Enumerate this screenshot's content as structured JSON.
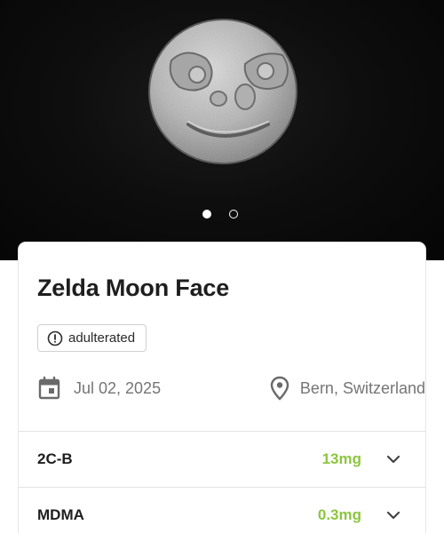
{
  "carousel": {
    "image_icon": "pill-photo-moon-face",
    "active_index": 0,
    "dots": [
      "slide-1",
      "slide-2"
    ]
  },
  "sample": {
    "title": "Zelda Moon Face",
    "status_badge": "adulterated",
    "status_icon": "alert-circle-icon",
    "date": "Jul 02, 2025",
    "date_icon": "calendar-icon",
    "location": "Bern, Switzerland",
    "location_icon": "map-pin-icon"
  },
  "substances": [
    {
      "name": "2C-B",
      "amount": "13mg",
      "icon": "chevron-down-icon"
    },
    {
      "name": "MDMA",
      "amount": "0.3mg",
      "icon": "chevron-down-icon"
    }
  ],
  "colors": {
    "amount_green": "#8cc63f",
    "title_text": "#1e1e1e",
    "muted_text": "#757575",
    "hero_background": "#0b0b0b"
  }
}
